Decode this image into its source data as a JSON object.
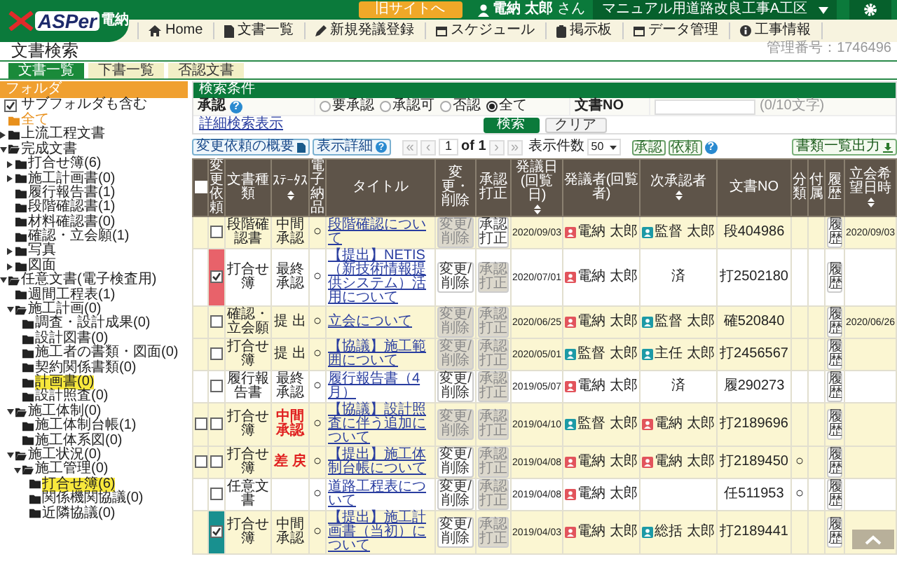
{
  "logo": {
    "main": "ASPer",
    "sub": "電納"
  },
  "top_bar": {
    "old_site_button": "旧サイトへ",
    "user": "電納 太郎",
    "user_suffix": "さん",
    "project": "マニュアル用道路改良工事A工区"
  },
  "nav": [
    {
      "label": "Home"
    },
    {
      "label": "文書一覧"
    },
    {
      "label": "新規発議登録"
    },
    {
      "label": "スケジュール"
    },
    {
      "label": "掲示板"
    },
    {
      "label": "データ管理"
    },
    {
      "label": "工事情報"
    }
  ],
  "management_no": "管理番号：1746496",
  "page_title": "文書検索",
  "tabs": [
    {
      "label": "文書一覧",
      "selected": true
    },
    {
      "label": "下書一覧",
      "selected": false
    },
    {
      "label": "否認文書",
      "selected": false
    }
  ],
  "sidebar": {
    "title": "フォルダ",
    "include_subfolders": {
      "label": "サブフォルダも含む",
      "checked": true
    },
    "tree": [
      {
        "label": "全て",
        "selected": true,
        "highlighted": false
      },
      {
        "label": "上流工程文書",
        "selected": false,
        "highlighted": false,
        "expanded": false
      },
      {
        "label": "完成文書",
        "selected": false,
        "highlighted": false,
        "expanded": true,
        "children": [
          {
            "label": "打合せ簿(6)",
            "selected": false,
            "highlighted": false,
            "expanded": false
          },
          {
            "label": "施工計画書(0)",
            "selected": false,
            "highlighted": false,
            "expanded": false
          },
          {
            "label": "履行報告書(1)",
            "selected": false,
            "highlighted": false
          },
          {
            "label": "段階確認書(1)",
            "selected": false,
            "highlighted": false
          },
          {
            "label": "材料確認書(0)",
            "selected": false,
            "highlighted": false
          },
          {
            "label": "確認・立会願(1)",
            "selected": false,
            "highlighted": false
          },
          {
            "label": "写真",
            "selected": false,
            "highlighted": false,
            "expanded": false
          },
          {
            "label": "図面",
            "selected": false,
            "highlighted": false,
            "expanded": false
          }
        ]
      },
      {
        "label": "任意文書(電子検査用)",
        "selected": false,
        "highlighted": false,
        "expanded": true,
        "children": [
          {
            "label": "週間工程表(1)",
            "selected": false,
            "highlighted": false
          },
          {
            "label": "施工計画(0)",
            "selected": false,
            "highlighted": false,
            "expanded": true,
            "children": [
              {
                "label": "調査・設計成果(0)",
                "selected": false,
                "highlighted": false
              },
              {
                "label": "設計図書(0)",
                "selected": false,
                "highlighted": false
              },
              {
                "label": "施工者の書類・図面(0)",
                "selected": false,
                "highlighted": false
              },
              {
                "label": "契約関係書類(0)",
                "selected": false,
                "highlighted": false
              },
              {
                "label": "計画書(0)",
                "selected": false,
                "highlighted": true
              },
              {
                "label": "設計照査(0)",
                "selected": false,
                "highlighted": false
              }
            ]
          },
          {
            "label": "施工体制(0)",
            "selected": false,
            "highlighted": false,
            "expanded": true,
            "children": [
              {
                "label": "施工体制台帳(1)",
                "selected": false,
                "highlighted": false
              },
              {
                "label": "施工体系図(0)",
                "selected": false,
                "highlighted": false
              }
            ]
          },
          {
            "label": "施工状況(0)",
            "selected": false,
            "highlighted": false,
            "expanded": true,
            "children": [
              {
                "label": "施工管理(0)",
                "selected": false,
                "highlighted": false,
                "expanded": true,
                "children": [
                  {
                    "label": "打合せ簿(6)",
                    "selected": false,
                    "highlighted": true
                  },
                  {
                    "label": "関係機関協議(0)",
                    "selected": false,
                    "highlighted": false
                  },
                  {
                    "label": "近隣協議(0)",
                    "selected": false,
                    "highlighted": false
                  }
                ]
              }
            ]
          }
        ]
      }
    ]
  },
  "search": {
    "title": "検索条件",
    "approval_label": "承認",
    "help": "?",
    "approval_options": [
      {
        "label": "要承認",
        "selected": false
      },
      {
        "label": "承認可",
        "selected": false
      },
      {
        "label": "否認",
        "selected": false
      },
      {
        "label": "全て",
        "selected": true
      }
    ],
    "doc_no_label": "文書NO",
    "doc_no_counter": "(0/10文字)",
    "detail_link": "詳細検索表示",
    "search_button": "検索",
    "clear_button": "クリア"
  },
  "toolbar": {
    "change_summary": "変更依頼の概要",
    "display_detail": "表示詳細",
    "detail_help": "?",
    "export": "書類一覧出力"
  },
  "pagination": {
    "first": "«",
    "prev": "‹",
    "page": "1",
    "of": "of 1",
    "next": "›",
    "last": "»",
    "per_page_label": "表示件数",
    "per_page": "50"
  },
  "actions": {
    "buttons": [
      "承認",
      "依頼"
    ],
    "help": "?"
  },
  "table": {
    "columns": [
      {
        "kind": "checkbox",
        "checked": false
      },
      {
        "label": "変更依頼"
      },
      {
        "label": "文書種類"
      },
      {
        "label": "ｽﾃｰﾀｽ",
        "sortable": true
      },
      {
        "label": "電子納品"
      },
      {
        "label": "タイトル"
      },
      {
        "label": "変更・削除"
      },
      {
        "label": "承認打正"
      },
      {
        "label": "発議日(回覧日)",
        "sortable": true
      },
      {
        "label": "発議者(回覧者)"
      },
      {
        "label": "次承認者",
        "sortable": true
      },
      {
        "label": "文書NO"
      },
      {
        "label": "分類"
      },
      {
        "label": "付属"
      },
      {
        "label": "履歴"
      },
      {
        "label": "立会希望日時",
        "sortable": true
      }
    ],
    "rows": [
      {
        "highlighted": true,
        "checkable": false,
        "change_requested": false,
        "type": "段階確認書",
        "status": "中間承認",
        "status_alert": false,
        "electronic": "○",
        "title": "段階確認について",
        "edit": {
          "label": "変更/削除",
          "disabled": true
        },
        "correct": {
          "label": "承認打正",
          "disabled": false
        },
        "date": "2020/09/03",
        "issuer": {
          "kind": "person",
          "name": "電納 太郎",
          "color": "#e2545c"
        },
        "next_approver": {
          "kind": "person",
          "name": "監督 太郎",
          "color": "#1c9aa6"
        },
        "doc_no": "段404986",
        "history": "履歴",
        "witness_date": "2020/09/03"
      },
      {
        "highlighted": false,
        "checkable": false,
        "change_requested": true,
        "color": "#e8626a",
        "type": "打合せ簿",
        "status": "最終承認",
        "status_alert": false,
        "electronic": "○",
        "title": "【提出】NETIS（新技術情報提供システム）活用について",
        "edit": {
          "label": "変更/削除",
          "disabled": false
        },
        "correct": {
          "label": "承認打正",
          "disabled": true
        },
        "date": "2020/07/01",
        "issuer": {
          "kind": "person",
          "name": "電納 太郎",
          "color": "#e2545c"
        },
        "next_approver": {
          "kind": "done",
          "text": "済"
        },
        "doc_no": "打2502180",
        "history": "履歴"
      },
      {
        "highlighted": true,
        "checkable": false,
        "change_requested": false,
        "type": "確認・立会願",
        "status": "提 出",
        "status_alert": false,
        "electronic": "○",
        "title": "立会について",
        "edit": {
          "label": "変更/削除",
          "disabled": true
        },
        "correct": {
          "label": "承認打正",
          "disabled": true
        },
        "date": "2020/06/25",
        "issuer": {
          "kind": "person",
          "name": "電納 太郎",
          "color": "#e2545c"
        },
        "next_approver": {
          "kind": "person",
          "name": "監督 太郎",
          "color": "#1c9aa6"
        },
        "doc_no": "確520840",
        "history": "履歴",
        "witness_date": "2020/06/26"
      },
      {
        "highlighted": true,
        "checkable": false,
        "change_requested": false,
        "type": "打合せ簿",
        "status": "提 出",
        "status_alert": false,
        "electronic": "○",
        "title": "【協議】施工範囲について",
        "edit": {
          "label": "変更/削除",
          "disabled": true
        },
        "correct": {
          "label": "承認打正",
          "disabled": true
        },
        "date": "2020/05/01",
        "issuer": {
          "kind": "person",
          "name": "監督 太郎",
          "color": "#1c9aa6"
        },
        "next_approver": {
          "kind": "person",
          "name": "主任 太郎",
          "color": "#1c9aa6"
        },
        "doc_no": "打2456567",
        "history": "履歴"
      },
      {
        "highlighted": false,
        "checkable": false,
        "change_requested": false,
        "type": "履行報告書",
        "status": "最終承認",
        "status_alert": false,
        "electronic": "○",
        "title": "履行報告書（4月）",
        "edit": {
          "label": "変更/削除",
          "disabled": false
        },
        "correct": {
          "label": "承認打正",
          "disabled": true
        },
        "date": "2019/05/07",
        "issuer": {
          "kind": "person",
          "name": "電納 太郎",
          "color": "#e2545c"
        },
        "next_approver": {
          "kind": "done",
          "text": "済"
        },
        "doc_no": "履290273",
        "history": "履歴"
      },
      {
        "highlighted": true,
        "checkable": true,
        "checked": false,
        "change_requested": false,
        "type": "打合せ簿",
        "status": "中間承認",
        "status_alert": true,
        "electronic": "○",
        "title": "【協議】設計照査に伴う追加について",
        "edit": {
          "label": "変更/削除",
          "disabled": true
        },
        "correct": {
          "label": "承認打正",
          "disabled": true
        },
        "date": "2019/04/10",
        "issuer": {
          "kind": "person",
          "name": "監督 太郎",
          "color": "#1c9aa6"
        },
        "next_approver": {
          "kind": "person",
          "name": "電納 太郎",
          "color": "#e2545c"
        },
        "doc_no": "打2189696",
        "history": "履歴"
      },
      {
        "highlighted": true,
        "checkable": true,
        "checked": false,
        "change_requested": false,
        "type": "打合せ簿",
        "status": "差 戻",
        "status_alert": true,
        "electronic": "○",
        "title": "【提出】施工体制台帳について",
        "edit": {
          "label": "変更/削除",
          "disabled": false
        },
        "correct": {
          "label": "承認打正",
          "disabled": true
        },
        "date": "2019/04/08",
        "issuer": {
          "kind": "person",
          "name": "電納 太郎",
          "color": "#e2545c"
        },
        "next_approver": {
          "kind": "person",
          "name": "電納 太郎",
          "color": "#e2545c"
        },
        "doc_no": "打2189450",
        "category": "○",
        "history": "履歴"
      },
      {
        "highlighted": false,
        "checkable": false,
        "change_requested": false,
        "type": "任意文書",
        "electronic": "○",
        "title": "道路工程表について",
        "edit": {
          "label": "変更/削除",
          "disabled": false
        },
        "correct": {
          "label": "承認打正",
          "disabled": true
        },
        "date": "2019/04/08",
        "issuer": {
          "kind": "person",
          "name": "電納 太郎",
          "color": "#e2545c"
        },
        "doc_no": "任511953",
        "category": "○",
        "history": "履歴"
      },
      {
        "highlighted": true,
        "checkable": false,
        "change_requested": true,
        "color": "#18908f",
        "type": "打合せ簿",
        "status": "中間承認",
        "status_alert": false,
        "electronic": "○",
        "title": "【提出】施工計画書（当初）について",
        "edit": {
          "label": "変更/削除",
          "disabled": false
        },
        "correct": {
          "label": "承認打正",
          "disabled": true
        },
        "date": "2019/04/03",
        "issuer": {
          "kind": "person",
          "name": "電納 太郎",
          "color": "#e2545c"
        },
        "next_approver": {
          "kind": "person",
          "name": "総括 太郎",
          "color": "#1c9aa6"
        },
        "doc_no": "打2189441",
        "history": "履歴"
      }
    ]
  }
}
